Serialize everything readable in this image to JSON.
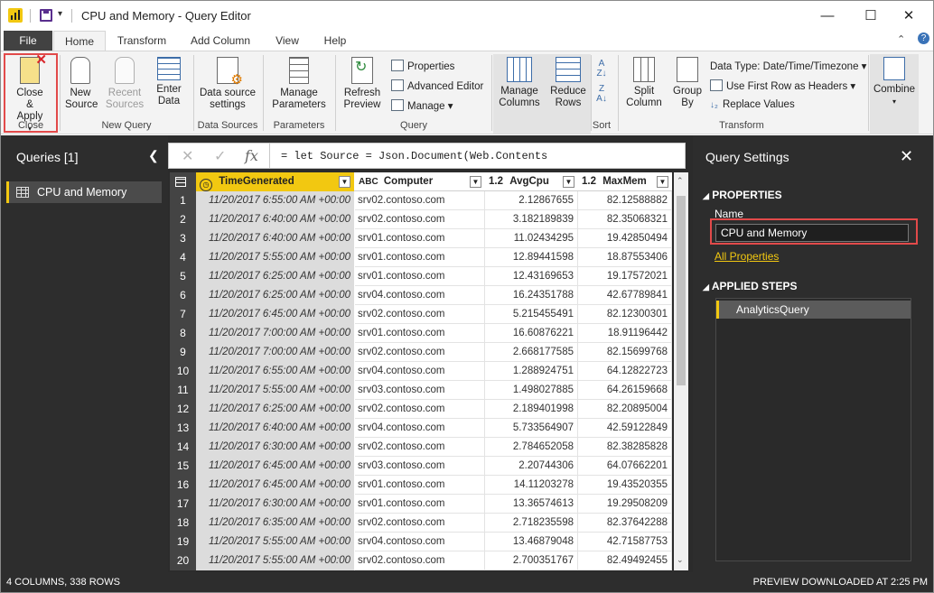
{
  "window": {
    "title": "CPU and Memory - Query Editor",
    "minimize": "—",
    "maximize": "☐",
    "close": "✕"
  },
  "tabs": [
    "File",
    "Home",
    "Transform",
    "Add Column",
    "View",
    "Help"
  ],
  "ribbon": {
    "close_apply": "Close & Apply",
    "new_source": "New Source",
    "recent_sources": "Recent Sources",
    "enter_data": "Enter Data",
    "data_source_settings": "Data source settings",
    "manage_parameters": "Manage Parameters",
    "refresh_preview": "Refresh Preview",
    "properties": "Properties",
    "advanced_editor": "Advanced Editor",
    "manage": "Manage",
    "manage_columns": "Manage Columns",
    "reduce_rows": "Reduce Rows",
    "split_column": "Split Column",
    "group_by": "Group By",
    "data_type": "Data Type: Date/Time/Timezone",
    "use_first_row": "Use First Row as Headers",
    "replace_values": "Replace Values",
    "combine": "Combine",
    "groups": {
      "close": "Close",
      "new_query": "New Query",
      "data_sources": "Data Sources",
      "parameters": "Parameters",
      "query": "Query",
      "sort": "Sort",
      "transform": "Transform"
    }
  },
  "queries_pane": {
    "title": "Queries [1]",
    "items": [
      "CPU and Memory"
    ]
  },
  "formula": "= let Source = Json.Document(Web.Contents",
  "grid": {
    "columns": [
      {
        "type": "",
        "name": "TimeGenerated"
      },
      {
        "type": "ABC",
        "name": "Computer"
      },
      {
        "type": "1.2",
        "name": "AvgCpu"
      },
      {
        "type": "1.2",
        "name": "MaxMem"
      }
    ],
    "rows": [
      [
        "1",
        "11/20/2017 6:55:00 AM +00:00",
        "srv02.contoso.com",
        "2.12867655",
        "82.12588882"
      ],
      [
        "2",
        "11/20/2017 6:40:00 AM +00:00",
        "srv02.contoso.com",
        "3.182189839",
        "82.35068321"
      ],
      [
        "3",
        "11/20/2017 6:40:00 AM +00:00",
        "srv01.contoso.com",
        "11.02434295",
        "19.42850494"
      ],
      [
        "4",
        "11/20/2017 5:55:00 AM +00:00",
        "srv01.contoso.com",
        "12.89441598",
        "18.87553406"
      ],
      [
        "5",
        "11/20/2017 6:25:00 AM +00:00",
        "srv01.contoso.com",
        "12.43169653",
        "19.17572021"
      ],
      [
        "6",
        "11/20/2017 6:25:00 AM +00:00",
        "srv04.contoso.com",
        "16.24351788",
        "42.67789841"
      ],
      [
        "7",
        "11/20/2017 6:45:00 AM +00:00",
        "srv02.contoso.com",
        "5.215455491",
        "82.12300301"
      ],
      [
        "8",
        "11/20/2017 7:00:00 AM +00:00",
        "srv01.contoso.com",
        "16.60876221",
        "18.91196442"
      ],
      [
        "9",
        "11/20/2017 7:00:00 AM +00:00",
        "srv02.contoso.com",
        "2.668177585",
        "82.15699768"
      ],
      [
        "10",
        "11/20/2017 6:55:00 AM +00:00",
        "srv04.contoso.com",
        "1.288924751",
        "64.12822723"
      ],
      [
        "11",
        "11/20/2017 5:55:00 AM +00:00",
        "srv03.contoso.com",
        "1.498027885",
        "64.26159668"
      ],
      [
        "12",
        "11/20/2017 6:25:00 AM +00:00",
        "srv02.contoso.com",
        "2.189401998",
        "82.20895004"
      ],
      [
        "13",
        "11/20/2017 6:40:00 AM +00:00",
        "srv04.contoso.com",
        "5.733564907",
        "42.59122849"
      ],
      [
        "14",
        "11/20/2017 6:30:00 AM +00:00",
        "srv02.contoso.com",
        "2.784652058",
        "82.38285828"
      ],
      [
        "15",
        "11/20/2017 6:45:00 AM +00:00",
        "srv03.contoso.com",
        "2.20744306",
        "64.07662201"
      ],
      [
        "16",
        "11/20/2017 6:45:00 AM +00:00",
        "srv01.contoso.com",
        "14.11203278",
        "19.43520355"
      ],
      [
        "17",
        "11/20/2017 6:30:00 AM +00:00",
        "srv01.contoso.com",
        "13.36574613",
        "19.29508209"
      ],
      [
        "18",
        "11/20/2017 6:35:00 AM +00:00",
        "srv02.contoso.com",
        "2.718235598",
        "82.37642288"
      ],
      [
        "19",
        "11/20/2017 5:55:00 AM +00:00",
        "srv04.contoso.com",
        "13.46879048",
        "42.71587753"
      ],
      [
        "20",
        "11/20/2017 5:55:00 AM +00:00",
        "srv02.contoso.com",
        "2.700351767",
        "82.49492455"
      ]
    ]
  },
  "settings_pane": {
    "title": "Query Settings",
    "properties_heading": "PROPERTIES",
    "name_label": "Name",
    "name_value": "CPU and Memory",
    "all_properties": "All Properties",
    "applied_steps_heading": "APPLIED STEPS",
    "steps": [
      "AnalyticsQuery"
    ]
  },
  "status": {
    "left": "4 COLUMNS, 338 ROWS",
    "right": "PREVIEW DOWNLOADED AT 2:25 PM"
  },
  "colors": {
    "accent": "#f2c811",
    "highlight": "#e24a4a",
    "pane_bg": "#2d2d2d"
  }
}
